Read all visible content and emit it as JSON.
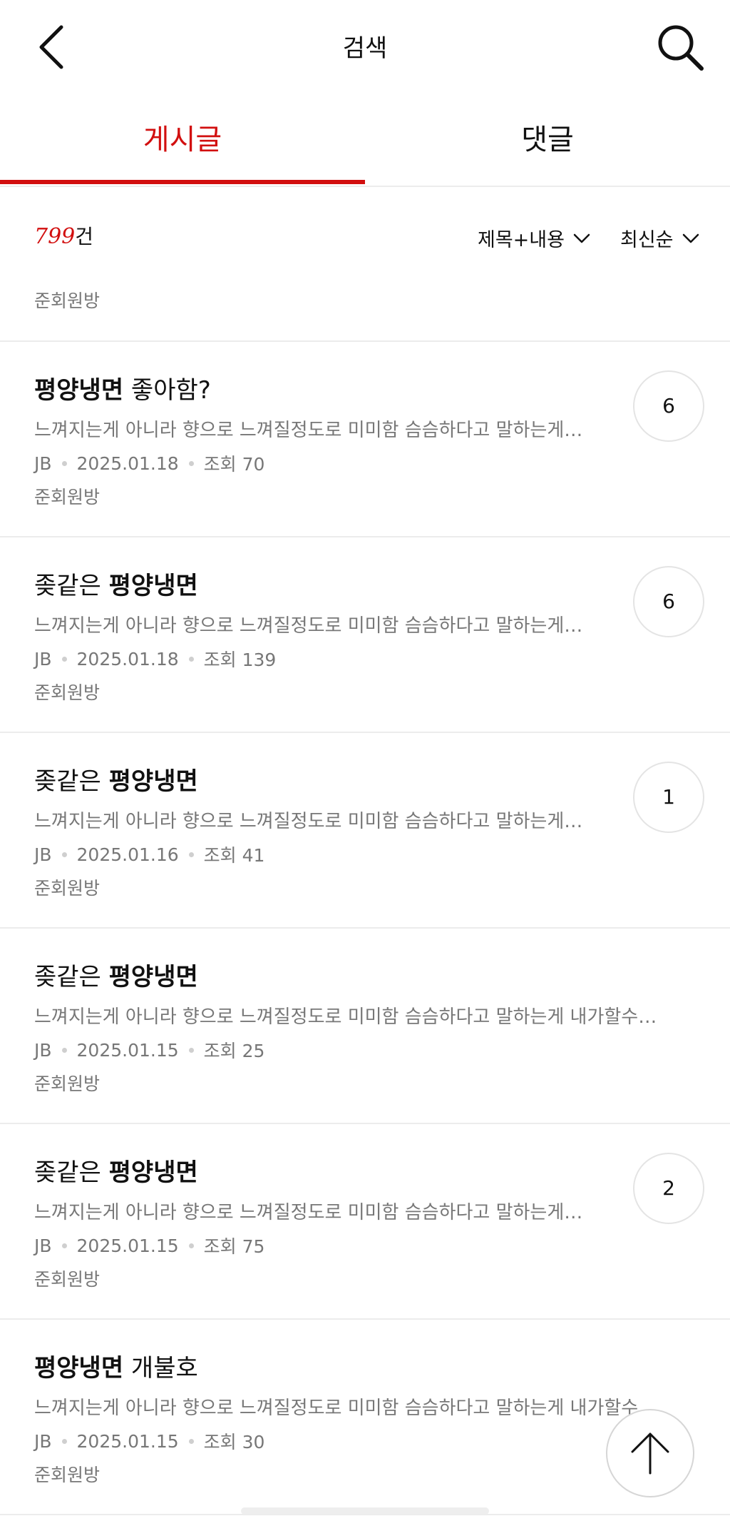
{
  "header": {
    "title": "검색",
    "back_icon": "chevron-left-icon",
    "search_icon": "search-icon"
  },
  "tabs": [
    {
      "label": "게시글",
      "active": true
    },
    {
      "label": "댓글",
      "active": false
    }
  ],
  "filter": {
    "count_number": "799",
    "count_suffix": "건",
    "scope_label": "제목+내용",
    "sort_label": "최신순",
    "board_label": "준회원방"
  },
  "posts": [
    {
      "title_highlight": "평양냉면",
      "title_rest": " 좋아함?",
      "highlight_first": true,
      "excerpt": "느껴지는게 아니라 향으로 느껴질정도로 미미함 슴슴하다고 말하는게…",
      "author": "JB",
      "date": "2025.01.18",
      "views": "조회 70",
      "board": "준회원방",
      "comments": "6"
    },
    {
      "title_prefix": "좆같은 ",
      "title_highlight": "평양냉면",
      "highlight_first": false,
      "excerpt": "느껴지는게 아니라 향으로 느껴질정도로 미미함 슴슴하다고 말하는게…",
      "author": "JB",
      "date": "2025.01.18",
      "views": "조회 139",
      "board": "준회원방",
      "comments": "6"
    },
    {
      "title_prefix": "좆같은 ",
      "title_highlight": "평양냉면",
      "highlight_first": false,
      "excerpt": "느껴지는게 아니라 향으로 느껴질정도로 미미함 슴슴하다고 말하는게…",
      "author": "JB",
      "date": "2025.01.16",
      "views": "조회 41",
      "board": "준회원방",
      "comments": "1"
    },
    {
      "title_prefix": "좆같은 ",
      "title_highlight": "평양냉면",
      "highlight_first": false,
      "excerpt": "느껴지는게 아니라 향으로 느껴질정도로 미미함 슴슴하다고 말하는게 내가할수…",
      "author": "JB",
      "date": "2025.01.15",
      "views": "조회 25",
      "board": "준회원방",
      "comments": ""
    },
    {
      "title_prefix": "좆같은 ",
      "title_highlight": "평양냉면",
      "highlight_first": false,
      "excerpt": "느껴지는게 아니라 향으로 느껴질정도로 미미함 슴슴하다고 말하는게…",
      "author": "JB",
      "date": "2025.01.15",
      "views": "조회 75",
      "board": "준회원방",
      "comments": "2"
    },
    {
      "title_highlight": "평양냉면",
      "title_rest": " 개불호",
      "highlight_first": true,
      "excerpt": "느껴지는게 아니라 향으로 느껴질정도로 미미함 슴슴하다고 말하는게 내가할수…",
      "author": "JB",
      "date": "2025.01.15",
      "views": "조회 30",
      "board": "준회원방",
      "comments": ""
    }
  ],
  "colors": {
    "accent": "#d20f0f",
    "muted": "#777777",
    "divider": "#ececec"
  },
  "scroll_top_icon": "arrow-up-icon"
}
